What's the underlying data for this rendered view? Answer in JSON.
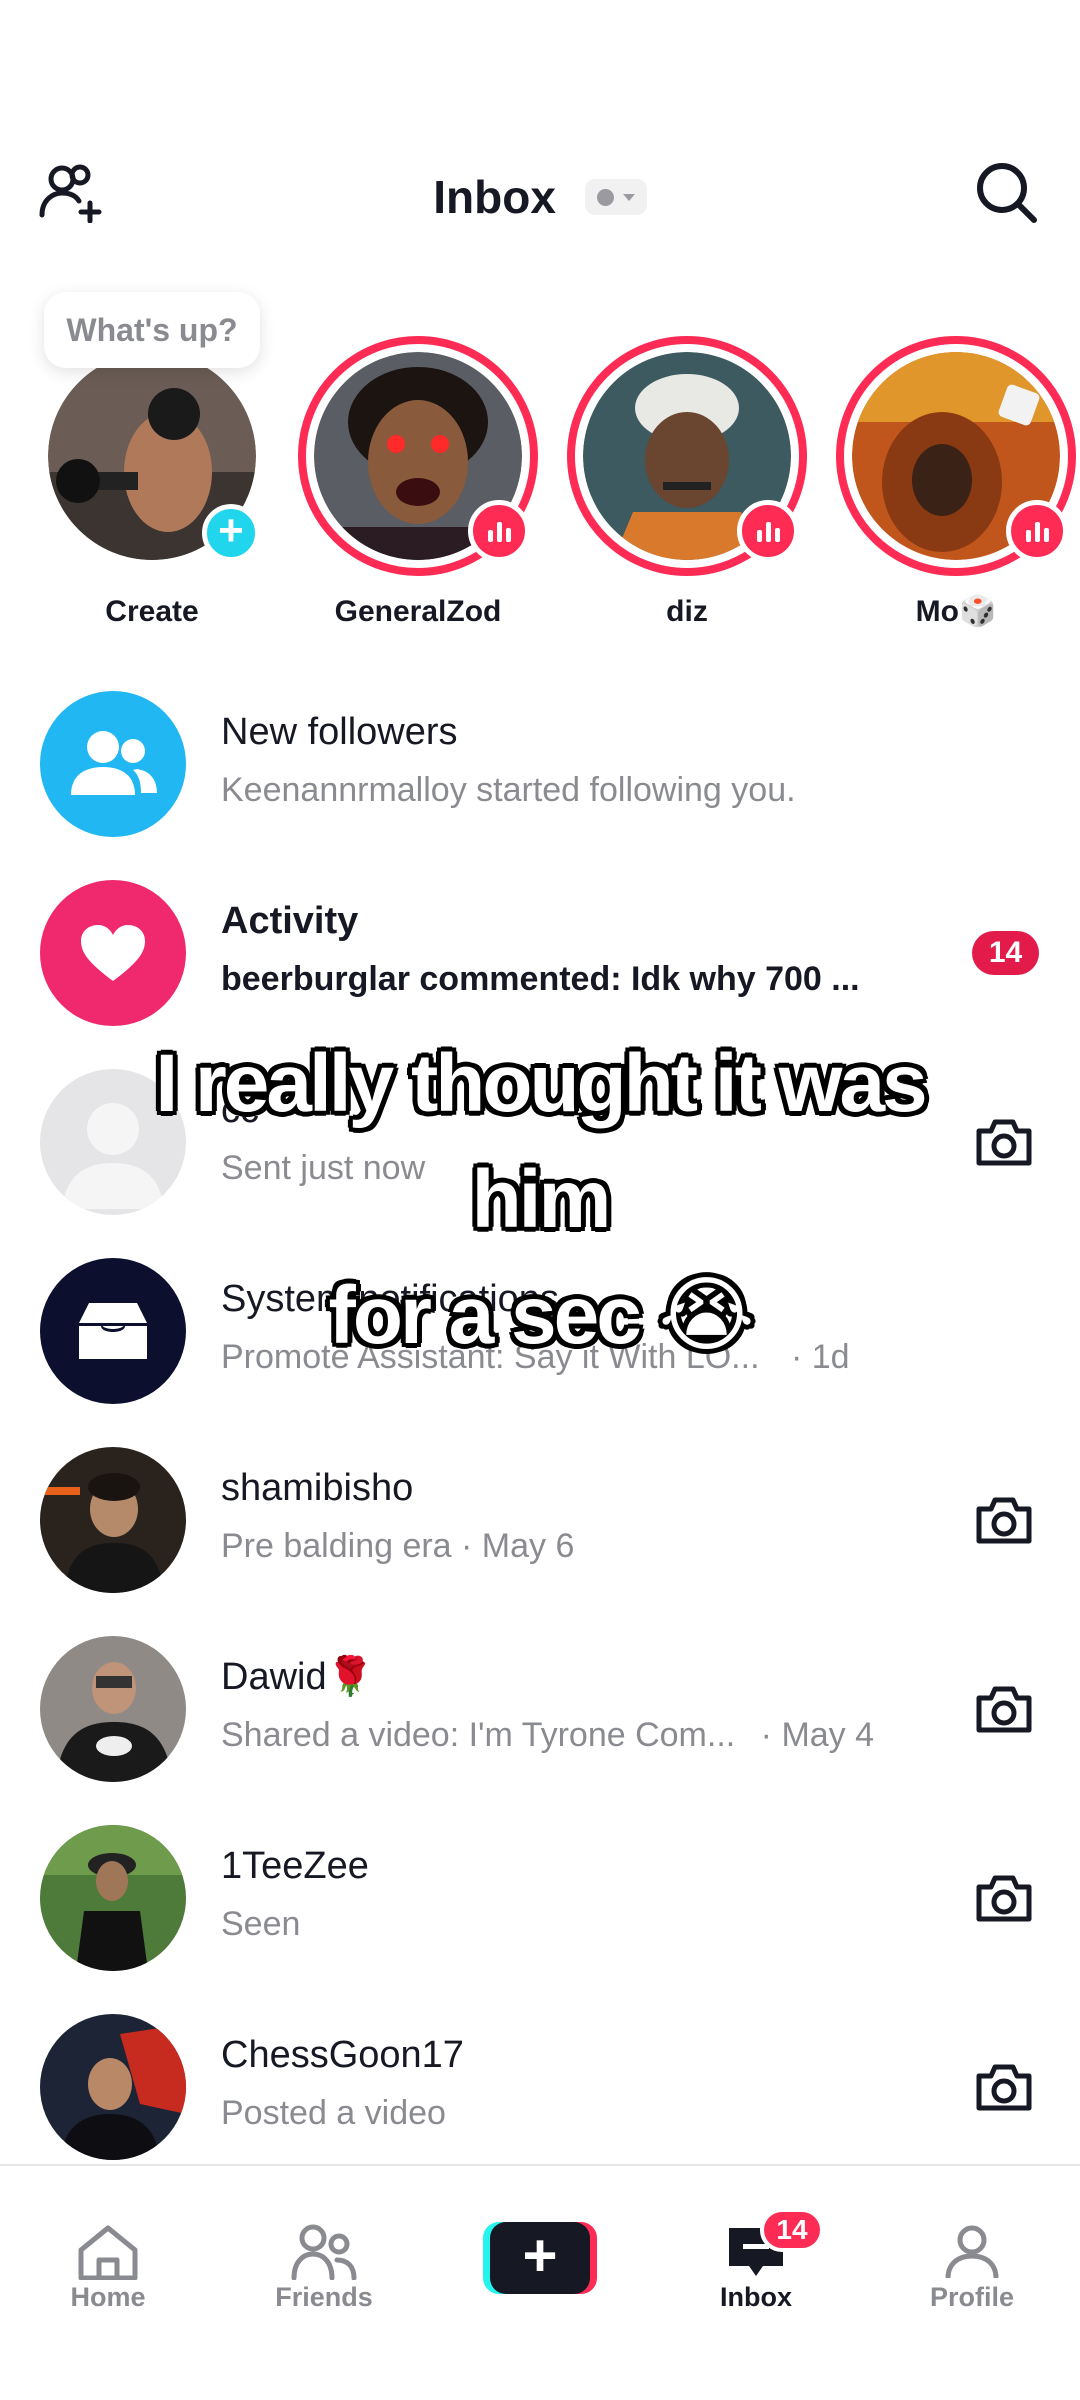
{
  "header": {
    "title": "Inbox",
    "add_friend_icon": "add-friend-icon",
    "search_icon": "search-icon"
  },
  "stories": {
    "bubble_text": "What's up?",
    "items": [
      {
        "name": "Create",
        "ring": false,
        "badge": "plus"
      },
      {
        "name": "GeneralZod",
        "ring": true,
        "badge": "live"
      },
      {
        "name": "diz",
        "ring": true,
        "badge": "live"
      },
      {
        "name": "Mo🎲",
        "ring": true,
        "badge": "live"
      }
    ]
  },
  "list": [
    {
      "title": "New followers",
      "subtitle": "Keenannrmalloy started following you.",
      "icon": "people-icon"
    },
    {
      "title": "Activity",
      "subtitle": "beerburglar commented: Idk why 700 ...",
      "badge": "14",
      "icon": "heart-icon"
    },
    {
      "title": "cc",
      "subtitle": "Sent just now",
      "icon": "camera-icon"
    },
    {
      "title": "System notifications",
      "subtitle": "Promote Assistant: Say it With LO...",
      "time": "· 1d",
      "icon": "inbox-tray-icon"
    },
    {
      "title": "shamibisho",
      "subtitle": "Pre balding era · May 6",
      "icon": "camera-icon"
    },
    {
      "title": "Dawid🌹",
      "subtitle": "Shared a video: I'm Tyrone Com...",
      "time": "· May 4",
      "icon": "camera-icon"
    },
    {
      "title": "1TeeZee",
      "subtitle": "Seen",
      "icon": "camera-icon"
    },
    {
      "title": "ChessGoon17",
      "subtitle": "Posted a video",
      "icon": "camera-icon"
    }
  ],
  "caption": {
    "line1": "I really thought it was",
    "line2": "him",
    "line3": "for a sec 😭"
  },
  "nav": {
    "home": "Home",
    "friends": "Friends",
    "inbox": "Inbox",
    "profile": "Profile",
    "inbox_badge": "14",
    "create_symbol": "+"
  },
  "colors": {
    "accent": "#fe2c55",
    "cyan": "#25f4ee",
    "followers_blue": "#20b7f2",
    "activity_pink": "#f0286d",
    "system_navy": "#0c0f2e"
  }
}
